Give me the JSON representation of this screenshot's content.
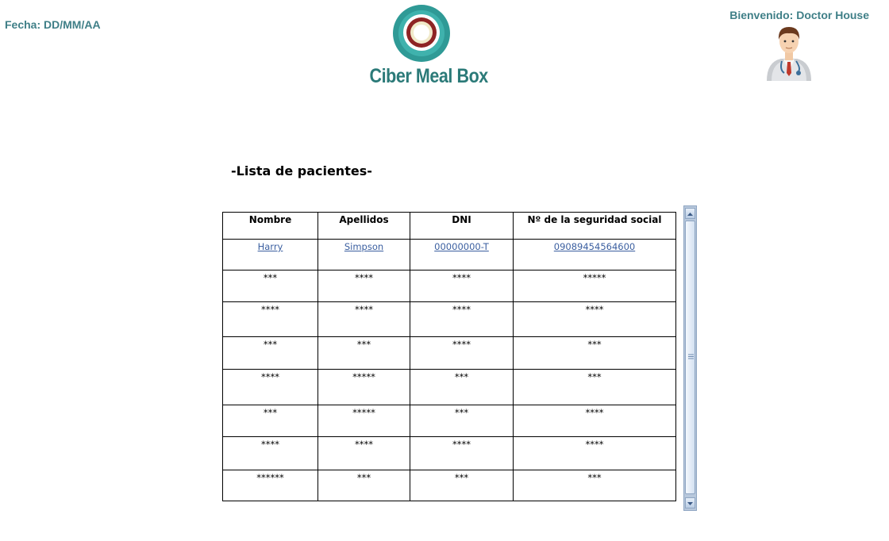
{
  "header": {
    "date_label": "Fecha: DD/MM/AA",
    "welcome_label": "Bienvenido: Doctor House",
    "logo_text": "Ciber Meal Box",
    "avatar_icon": "doctor-avatar-icon",
    "brand_color": "#3f7f87"
  },
  "main": {
    "title": "-Lista de pacientes-"
  },
  "table": {
    "columns": [
      "Nombre",
      "Apellidos",
      "DNI",
      "Nº de la seguridad social"
    ],
    "link_row": [
      "Harry",
      "Simpson",
      "00000000-T",
      "09089454564600"
    ],
    "rows": [
      [
        "***",
        "****",
        "****",
        "*****"
      ],
      [
        "****",
        "****",
        "****",
        "****"
      ],
      [
        "***",
        "***",
        "****",
        "***"
      ],
      [
        "****",
        "*****",
        "***",
        "***"
      ],
      [
        "***",
        "*****",
        "***",
        "****"
      ],
      [
        "****",
        "****",
        "****",
        "****"
      ],
      [
        "******",
        "***",
        "***",
        "***"
      ]
    ]
  }
}
